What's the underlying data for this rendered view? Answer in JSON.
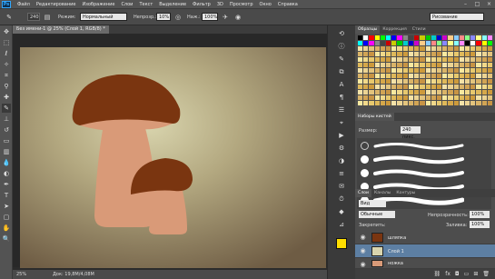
{
  "app": {
    "logo": "Ps"
  },
  "menu": [
    "Файл",
    "Редактирование",
    "Изображение",
    "Слои",
    "Текст",
    "Выделение",
    "Фильтр",
    "3D",
    "Просмотр",
    "Окно",
    "Справка"
  ],
  "window_buttons": {
    "minimize": "–",
    "maximize": "□",
    "close": "×"
  },
  "options_bar": {
    "brush_size": "240",
    "mode_label": "Режим:",
    "mode_value": "Нормальный",
    "opacity_label": "Непрозр.:",
    "opacity_value": "10%",
    "pressure_label": "Наж.:",
    "pressure_value": "100%",
    "workspace": "Рисование"
  },
  "document": {
    "tab_title": "Без имени-1 @ 25% (Слой 1, RGB/8) *",
    "zoom": "25%",
    "doc_info": "Док: 19,8M/4,08M"
  },
  "panels": {
    "top_tabs": [
      "Образцы",
      "Коррекция",
      "Стили"
    ],
    "brushes_title": "Наборы кистей",
    "brush_size_label": "Размер:",
    "brush_size_value": "240 пикс.",
    "layers_tabs": [
      "Слои",
      "Каналы",
      "Контуры"
    ],
    "layers_filter": "Вид",
    "blend_mode": "Обычные",
    "opacity_label": "Непрозрачность:",
    "opacity_value": "100%",
    "lock_label": "Закрепить:",
    "fill_label": "Заливка:",
    "fill_value": "100%",
    "layers": [
      {
        "name": "шляпка",
        "selected": false
      },
      {
        "name": "Слой 1",
        "selected": true
      },
      {
        "name": "ножка",
        "selected": false
      }
    ]
  },
  "colors": {
    "cap": "#7a3510",
    "stem": "#d99a78",
    "background_dark": "#6e5c44",
    "background_light": "#cdc79e",
    "selection": "#5d7fa3"
  }
}
